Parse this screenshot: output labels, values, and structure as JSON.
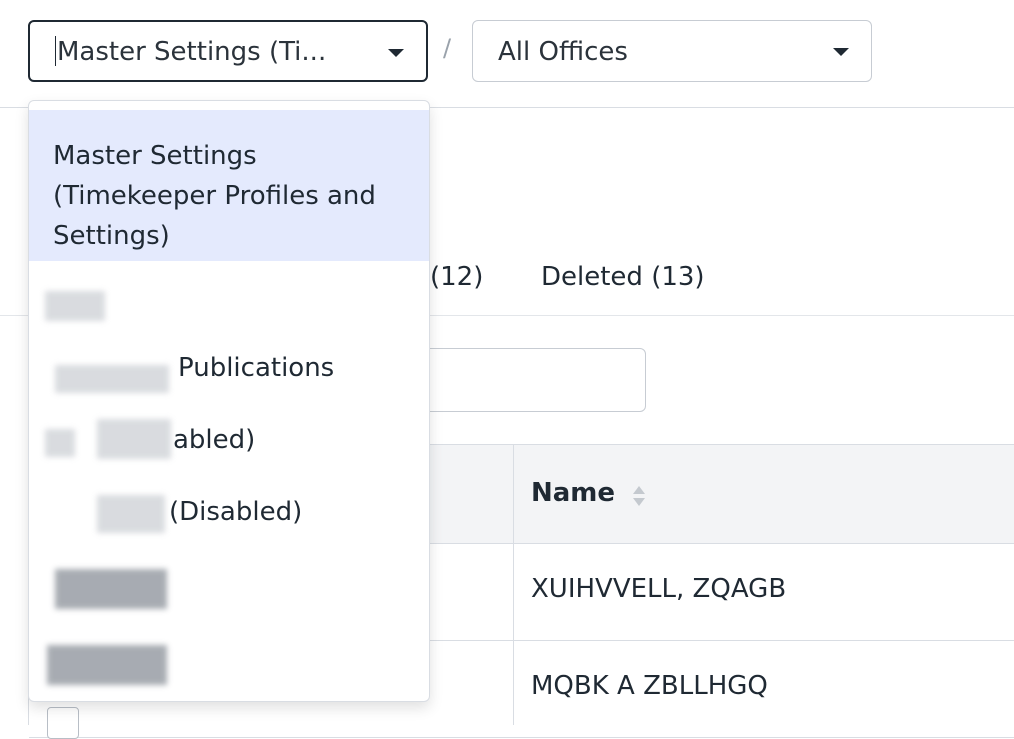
{
  "header": {
    "company_select": {
      "value": "Master Settings (Ti..."
    },
    "separator": "/",
    "office_select": {
      "value": "All Offices"
    }
  },
  "dropdown": {
    "options": [
      {
        "label": "Master Settings (Timekeeper Profiles and Settings)",
        "selected": true
      },
      {
        "label": ""
      },
      {
        "label": "Publications"
      },
      {
        "label": "abled)"
      },
      {
        "label": "(Disabled)"
      },
      {
        "label": ""
      },
      {
        "label": ""
      }
    ]
  },
  "tabs": {
    "active_count_label": "(12)",
    "deleted_label": "Deleted (13)"
  },
  "table": {
    "columns": [
      {
        "label": "Name"
      }
    ],
    "rows": [
      {
        "name": "XUIHVVELL, ZQAGB"
      },
      {
        "name": "MQBK A ZBLLHGQ"
      }
    ]
  },
  "colors": {
    "selected_bg": "#e4eafd",
    "border": "#d9dde3",
    "text": "#1f2933"
  }
}
